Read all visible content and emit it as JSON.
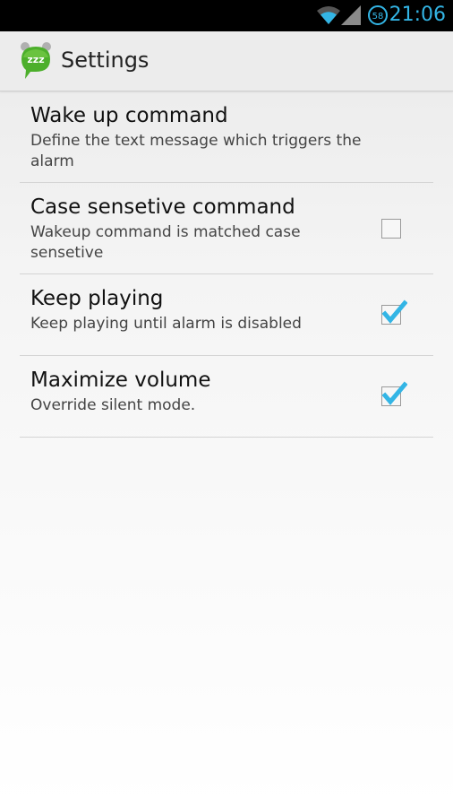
{
  "status_bar": {
    "time": "21:06",
    "battery_level": "58",
    "accent_color": "#33b5e5"
  },
  "action_bar": {
    "title": "Settings",
    "app_icon": "zzz-alarm-icon",
    "app_icon_text": "zzz"
  },
  "preferences": [
    {
      "title": "Wake up command",
      "summary": "Define the text message which triggers the alarm",
      "has_checkbox": false
    },
    {
      "title": "Case sensetive command",
      "summary": "Wakeup command is matched case sensetive",
      "has_checkbox": true,
      "checked": false
    },
    {
      "title": "Keep playing",
      "summary": "Keep playing until alarm is disabled",
      "has_checkbox": true,
      "checked": true
    },
    {
      "title": "Maximize volume",
      "summary": "Override silent mode.",
      "has_checkbox": true,
      "checked": true
    }
  ]
}
